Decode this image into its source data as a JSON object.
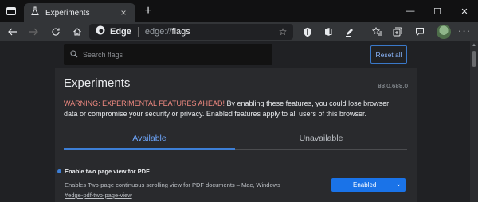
{
  "tabstrip": {
    "tab_actions_icon": "tab-actions-icon",
    "tab": {
      "title": "Experiments",
      "icon": "flask-icon",
      "close": "×"
    },
    "new_tab": "+",
    "window": {
      "minimize": "—",
      "maximize": "☐",
      "close": "✕"
    }
  },
  "toolbar": {
    "back": "←",
    "forward": "→",
    "refresh": "↻",
    "home": "⌂",
    "omnibox": {
      "brand": "Edge",
      "url_prefix": "edge://",
      "url_path": "flags",
      "favorite": "☆"
    },
    "menu": "···"
  },
  "header": {
    "search": {
      "placeholder": "Search flags"
    },
    "reset_label": "Reset all"
  },
  "main": {
    "title": "Experiments",
    "version": "88.0.688.0",
    "warning_strong": "WARNING: EXPERIMENTAL FEATURES AHEAD!",
    "warning_text": " By enabling these features, you could lose browser data or compromise your security or privacy. Enabled features apply to all users of this browser.",
    "tabs": [
      {
        "label": "Available",
        "active": true
      },
      {
        "label": "Unavailable",
        "active": false
      }
    ],
    "flags": [
      {
        "name": "Enable two page view for PDF",
        "description": "Enables Two-page continuous scrolling view for PDF documents – Mac, Windows",
        "link": "#edge-pdf-two-page-view",
        "value": "Enabled",
        "modified": true
      }
    ]
  },
  "colors": {
    "accent": "#1a73e8",
    "link_blue": "#8ab4f8",
    "warning_red": "#f28b82",
    "page_bg": "#202124",
    "panel_bg": "#292a2d"
  }
}
